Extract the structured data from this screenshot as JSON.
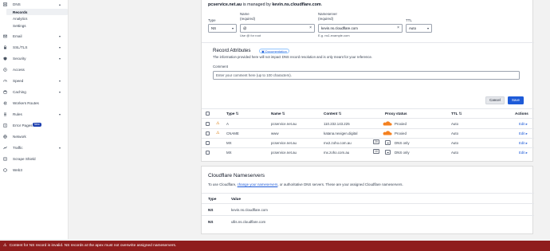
{
  "sidebar": {
    "items": [
      {
        "label": "DNS",
        "icon": "dns-icon",
        "chevron": "▴"
      },
      {
        "label": "Records",
        "sub": true,
        "active": true
      },
      {
        "label": "Analytics",
        "sub": true
      },
      {
        "label": "Settings",
        "sub": true
      },
      {
        "label": "Email",
        "icon": "email-icon",
        "chevron": "▾"
      },
      {
        "label": "SSL/TLS",
        "icon": "lock-icon",
        "chevron": "▾"
      },
      {
        "label": "Security",
        "icon": "shield-icon",
        "chevron": "▾"
      },
      {
        "label": "Access",
        "icon": "access-icon"
      },
      {
        "label": "Speed",
        "icon": "speed-icon",
        "chevron": "▾"
      },
      {
        "label": "Caching",
        "icon": "caching-icon",
        "chevron": "▾"
      },
      {
        "label": "Workers Routes",
        "icon": "workers-icon"
      },
      {
        "label": "Rules",
        "icon": "rules-icon",
        "chevron": "▾"
      },
      {
        "label": "Error Pages",
        "icon": "error-pages-icon",
        "badge": "New"
      },
      {
        "label": "Network",
        "icon": "network-icon"
      },
      {
        "label": "Traffic",
        "icon": "traffic-icon",
        "chevron": "▾"
      },
      {
        "label": "Scrape Shield",
        "icon": "scrape-shield-icon"
      },
      {
        "label": "Web3",
        "icon": "web3-icon"
      }
    ]
  },
  "managed": {
    "domain": "pcservice.net.au",
    "middle": " is managed by ",
    "ns": "kevin.ns.cloudflare.com",
    "end": "."
  },
  "form": {
    "type_label": "Type",
    "type_value": "NS",
    "name_label": "Name",
    "name_required": "(required)",
    "name_value": "@",
    "name_help": "Use @ for root",
    "ns_label": "Nameserver",
    "ns_required": "(required)",
    "ns_value": "kevin.ns.cloudflare.com",
    "ns_help": "E.g. ns1.example.com",
    "ttl_label": "TTL",
    "ttl_value": "Auto"
  },
  "attributes": {
    "title": "Record Attributes",
    "doc_link": "Documentation",
    "info": "The information provided here will not impact DNS record resolution and is only meant for your reference.",
    "comment_label": "Comment",
    "comment_placeholder": "Enter your comment here (up to 100 characters)."
  },
  "buttons": {
    "cancel": "Cancel",
    "save": "Save"
  },
  "table": {
    "headers": {
      "type": "Type",
      "name": "Name",
      "content": "Content",
      "proxy": "Proxy status",
      "ttl": "TTL",
      "actions": "Actions"
    },
    "rows": [
      {
        "warn": true,
        "type": "A",
        "name": "pcservice.net.au",
        "content": "110.232.143.225",
        "proxy": "Proxied",
        "proxied": true,
        "ttl": "Auto",
        "action": "Edit"
      },
      {
        "warn": true,
        "type": "CNAME",
        "name": "www",
        "content": "katana.nexigen.digital",
        "proxy": "Proxied",
        "proxied": true,
        "ttl": "Auto",
        "action": "Edit"
      },
      {
        "warn": false,
        "type": "MX",
        "name": "pcservice.net.au",
        "content": "mx2.zoho.com.au",
        "badge": "20",
        "proxy": "DNS only",
        "proxied": false,
        "ttl": "Auto",
        "action": "Edit"
      },
      {
        "warn": false,
        "type": "MX",
        "name": "pcservice.net.au",
        "content": "mx.zoho.com.au",
        "badge": "10",
        "proxy": "DNS only",
        "proxied": false,
        "ttl": "Auto",
        "action": "Edit"
      }
    ]
  },
  "nameservers": {
    "title": "Cloudflare Nameservers",
    "desc_pre": "To use Cloudflare, ",
    "desc_link": "change your nameservers",
    "desc_post": ", or authoritative DNS servers. These are your assigned Cloudflare nameservers.",
    "headers": {
      "type": "Type",
      "value": "Value"
    },
    "rows": [
      {
        "type": "NS",
        "value": "kevin.ns.cloudflare.com"
      },
      {
        "type": "NS",
        "value": "ullis.ns.cloudflare.com"
      }
    ]
  },
  "error_banner": "Content for NS record is invalid. NS records at the apex must not overwrite assigned nameservers.",
  "colors": {
    "accent": "#1e5bd8",
    "error_banner": "#8f1d1d",
    "proxied_orange": "#f48120",
    "warning": "#d97706"
  }
}
